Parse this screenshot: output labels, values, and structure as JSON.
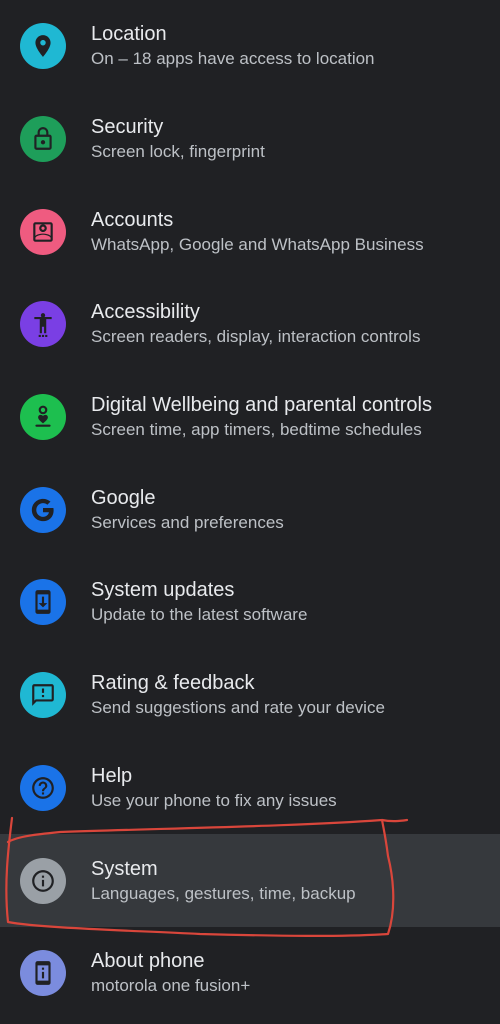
{
  "settings": {
    "items": [
      {
        "title": "Location",
        "subtitle": "On – 18 apps have access to location",
        "icon": "location-icon",
        "color": "#1fb8d3"
      },
      {
        "title": "Security",
        "subtitle": "Screen lock, fingerprint",
        "icon": "lock-icon",
        "color": "#1e9e5a"
      },
      {
        "title": "Accounts",
        "subtitle": "WhatsApp, Google and WhatsApp Business",
        "icon": "account-icon",
        "color": "#ef5b80"
      },
      {
        "title": "Accessibility",
        "subtitle": "Screen readers, display, interaction controls",
        "icon": "accessibility-icon",
        "color": "#7a3fe4"
      },
      {
        "title": "Digital Wellbeing and parental controls",
        "subtitle": "Screen time, app timers, bedtime schedules",
        "icon": "wellbeing-icon",
        "color": "#1dbf4f"
      },
      {
        "title": "Google",
        "subtitle": "Services and preferences",
        "icon": "google-icon",
        "color": "#1a73e8"
      },
      {
        "title": "System updates",
        "subtitle": "Update to the latest software",
        "icon": "system-update-icon",
        "color": "#1a73e8"
      },
      {
        "title": "Rating & feedback",
        "subtitle": "Send suggestions and rate your device",
        "icon": "feedback-icon",
        "color": "#1fb8d3"
      },
      {
        "title": "Help",
        "subtitle": "Use your phone to fix any issues",
        "icon": "help-icon",
        "color": "#1a73e8"
      },
      {
        "title": "System",
        "subtitle": "Languages, gestures, time, backup",
        "icon": "info-icon",
        "color": "#9aa0a6"
      },
      {
        "title": "About phone",
        "subtitle": "motorola one fusion+",
        "icon": "phone-info-icon",
        "color": "#7b8cde"
      }
    ]
  },
  "colors": {
    "background": "#202124",
    "highlight_row": "#36393d",
    "annotation_stroke": "#d9463b"
  }
}
